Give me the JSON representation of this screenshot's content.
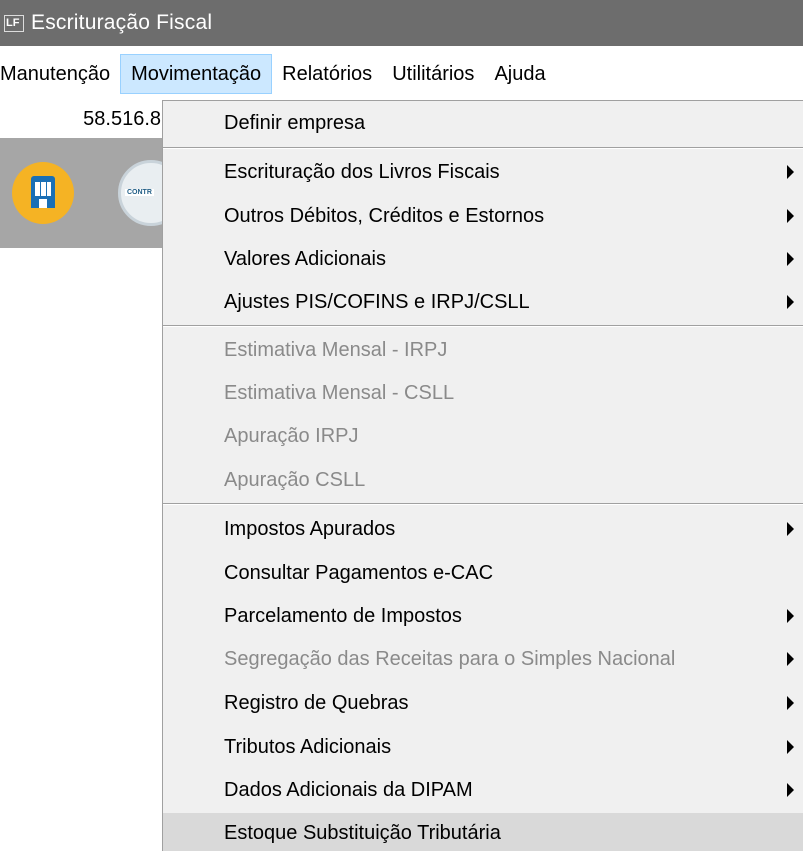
{
  "window": {
    "icon_text": "LF",
    "title": "Escrituração Fiscal"
  },
  "menubar": {
    "items": [
      "Manutenção",
      "Movimentação",
      "Relatórios",
      "Utilitários",
      "Ajuda"
    ],
    "active": "Movimentação"
  },
  "background": {
    "field_value": "58.516.8",
    "contr_icon_text": "CONTR"
  },
  "dropdown": {
    "items": [
      {
        "label": "Definir empresa",
        "enabled": true,
        "submenu": false
      },
      {
        "label": "Escrituração dos Livros Fiscais",
        "enabled": true,
        "submenu": true
      },
      {
        "label": "Outros Débitos, Créditos e Estornos",
        "enabled": true,
        "submenu": true
      },
      {
        "label": "Valores Adicionais",
        "enabled": true,
        "submenu": true
      },
      {
        "label": "Ajustes PIS/COFINS e IRPJ/CSLL",
        "enabled": true,
        "submenu": true
      },
      {
        "label": "Estimativa Mensal - IRPJ",
        "enabled": false,
        "submenu": false
      },
      {
        "label": "Estimativa Mensal - CSLL",
        "enabled": false,
        "submenu": false
      },
      {
        "label": "Apuração IRPJ",
        "enabled": false,
        "submenu": false
      },
      {
        "label": "Apuração CSLL",
        "enabled": false,
        "submenu": false
      },
      {
        "label": "Impostos Apurados",
        "enabled": true,
        "submenu": true
      },
      {
        "label": "Consultar Pagamentos e-CAC",
        "enabled": true,
        "submenu": false
      },
      {
        "label": "Parcelamento de Impostos",
        "enabled": true,
        "submenu": true
      },
      {
        "label": "Segregação das Receitas para o Simples Nacional",
        "enabled": false,
        "submenu": true
      },
      {
        "label": "Registro de Quebras",
        "enabled": true,
        "submenu": true
      },
      {
        "label": "Tributos Adicionais",
        "enabled": true,
        "submenu": true
      },
      {
        "label": "Dados Adicionais da DIPAM",
        "enabled": true,
        "submenu": true
      },
      {
        "label": "Estoque Substituição Tributária",
        "enabled": true,
        "submenu": false,
        "highlighted": true
      }
    ]
  }
}
